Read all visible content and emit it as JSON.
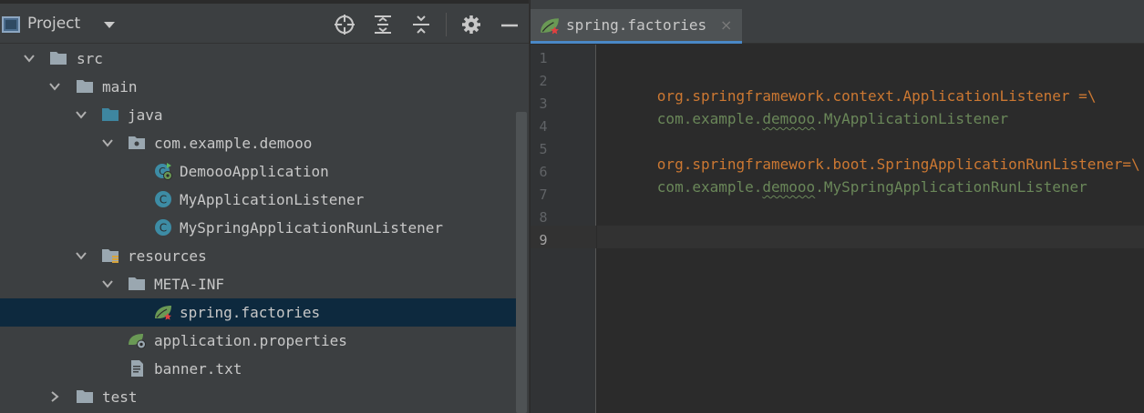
{
  "project_panel": {
    "title": "Project",
    "toolbar": [
      "locate-icon",
      "expand-all-icon",
      "collapse-all-icon",
      "gear-icon",
      "minimize-icon"
    ]
  },
  "tree": [
    {
      "label": "src",
      "type": "folder",
      "expanded": true
    },
    {
      "label": "main",
      "type": "folder",
      "expanded": true
    },
    {
      "label": "java",
      "type": "source-folder",
      "expanded": true
    },
    {
      "label": "com.example.demooo",
      "type": "package",
      "expanded": true
    },
    {
      "label": "DemoooApplication",
      "type": "spring-boot-class"
    },
    {
      "label": "MyApplicationListener",
      "type": "class"
    },
    {
      "label": "MySpringApplicationRunListener",
      "type": "class"
    },
    {
      "label": "resources",
      "type": "resources-folder",
      "expanded": true
    },
    {
      "label": "META-INF",
      "type": "folder",
      "expanded": true
    },
    {
      "label": "spring.factories",
      "type": "spring-file",
      "selected": true
    },
    {
      "label": "application.properties",
      "type": "spring-properties"
    },
    {
      "label": "banner.txt",
      "type": "text-file"
    },
    {
      "label": "test",
      "type": "folder",
      "expanded": false
    }
  ],
  "editor": {
    "tab": {
      "label": "spring.factories",
      "close": "×"
    },
    "line_numbers": [
      "1",
      "2",
      "3",
      "4",
      "5",
      "6",
      "7",
      "8",
      "9"
    ],
    "current_line": 9,
    "lines": {
      "l2_key": "org.springframework.context.ApplicationListener",
      "l2_op": " =\\",
      "l3_a": "com.example.",
      "l3_b": "demooo",
      "l3_c": ".MyApplicationListener",
      "l5_key": "org.springframework.boot.SpringApplicationRunListener",
      "l5_op": "=\\",
      "l6_a": "com.example.",
      "l6_b": "demooo",
      "l6_c": ".MySpringApplicationRunListener"
    }
  },
  "colors": {
    "panel_bg": "#3c3f41",
    "editor_bg": "#2b2b2b",
    "selection": "#0d293e",
    "key": "#cc7832",
    "value": "#6a8759",
    "accent": "#4a88c7"
  }
}
